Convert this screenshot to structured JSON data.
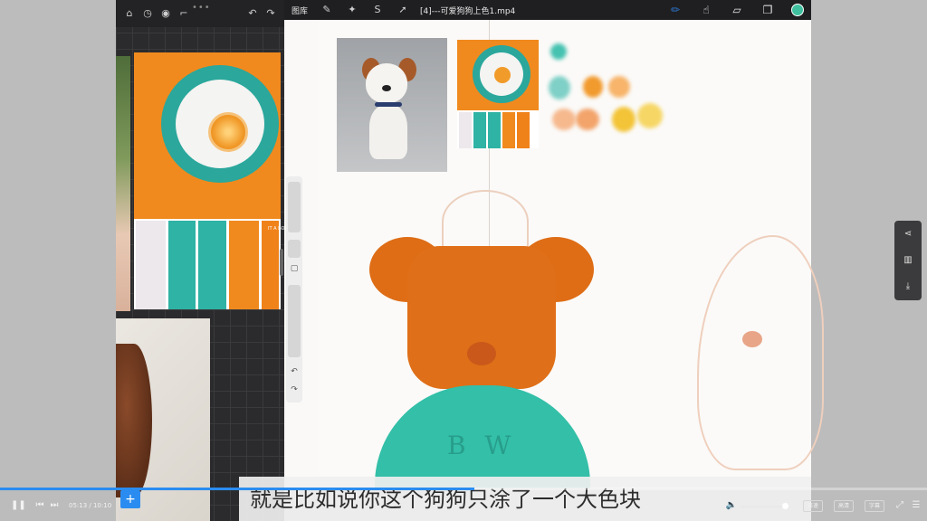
{
  "drawing_app": {
    "gallery_label": "图库",
    "file_title": "[4]---可爱狗狗上色1.mp4",
    "tools": [
      "brush",
      "smudge",
      "eraser",
      "layers"
    ],
    "color": "#3fbf9e"
  },
  "reference_panel": {
    "palette_swatches": [
      "#ece8ec",
      "#2fb3a5",
      "#2fb3a5",
      "#f08a1e",
      "#f0821a"
    ],
    "palette_label": "IT A\nBO\nSIA"
  },
  "canvas": {
    "shirt_text": "B W",
    "color_blobs": [
      "#46c2b1",
      "#7fd0c7",
      "#f19a2e",
      "#f7b46a",
      "#f6b98e",
      "#f3a46b",
      "#f3c437",
      "#f6d665"
    ]
  },
  "subtitle": "就是比如说你这个狗狗只涂了一个大色块",
  "player": {
    "time": "05:13 / 10:10",
    "progress": 0.512,
    "volume": 0.9,
    "buttons": {
      "speed": "倍速",
      "quality": "高清",
      "captions": "字幕"
    }
  }
}
